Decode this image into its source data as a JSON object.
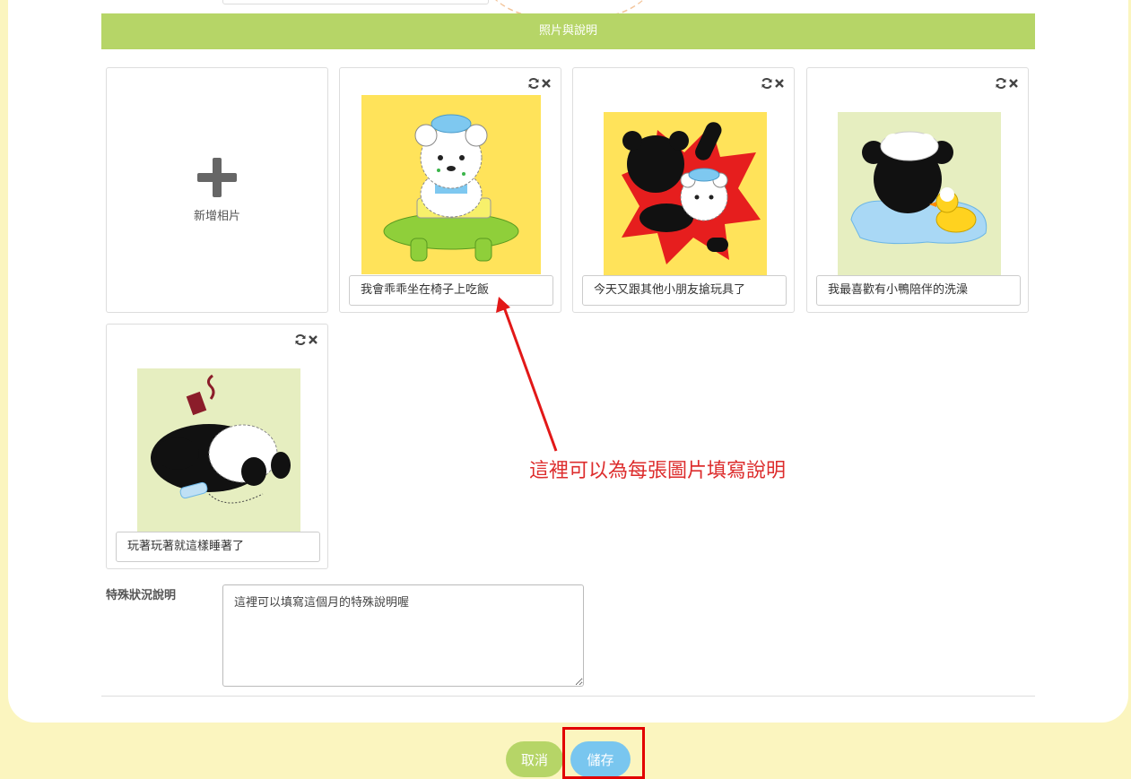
{
  "section": {
    "title": "照片與說明"
  },
  "add_photo": {
    "label": "新增相片"
  },
  "photos": [
    {
      "caption": "我會乖乖坐在椅子上吃飯",
      "bg": "#ffe35a"
    },
    {
      "caption": "今天又跟其他小朋友搶玩具了",
      "bg": "#ffe35a"
    },
    {
      "caption": "我最喜歡有小鴨陪伴的洗澡",
      "bg": "#e6eec0"
    },
    {
      "caption": "玩著玩著就這樣睡著了",
      "bg": "#e6eec0"
    }
  ],
  "annotation": {
    "text": "這裡可以為每張圖片填寫說明",
    "color": "#dd2d2d"
  },
  "special": {
    "label": "特殊狀況說明",
    "value": "這裡可以填寫這個月的特殊說明喔"
  },
  "buttons": {
    "cancel": "取消",
    "save": "儲存"
  },
  "colors": {
    "page_bg": "#fbf5bf",
    "accent_green": "#b6d567",
    "accent_blue": "#79c6ef",
    "highlight_red": "#e20000"
  },
  "icons": {
    "refresh": "refresh-icon",
    "remove": "close-icon",
    "add": "plus-icon"
  }
}
